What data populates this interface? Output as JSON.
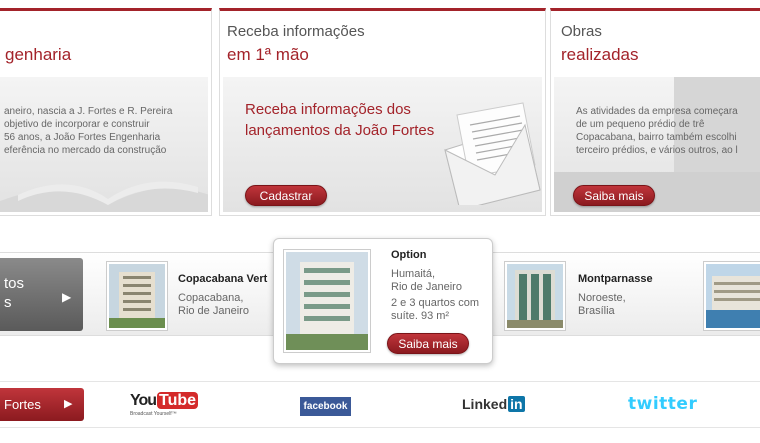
{
  "cards": [
    {
      "title_line1": "",
      "title_line2": "genharia",
      "text_lines": [
        "aneiro, nascia a J. Fortes e R. Pereira",
        "objetivo de incorporar e construir",
        "56 anos, a João Fortes Engenharia",
        "eferência no mercado da construção"
      ]
    },
    {
      "title_line1": "Receba informações",
      "title_line2": "em 1ª mão",
      "promo_line1": "Receba informações dos",
      "promo_line2": "lançamentos da João Fortes",
      "button": "Cadastrar"
    },
    {
      "title_line1": "Obras",
      "title_line2": "realizadas",
      "text_lines": [
        "As atividades da empresa começara",
        "de um pequeno prédio de trê",
        "Copacabana, bairro também escolhi",
        "terceiro prédios, e vários outros, ao l"
      ],
      "button": "Saiba mais"
    }
  ],
  "strip": {
    "left_button_lines": [
      "tos",
      "s"
    ],
    "items": [
      {
        "name": "Copacabana Vert",
        "loc_line1": "Copacabana,",
        "loc_line2": "Rio de Janeiro"
      },
      {
        "name": "Montparnasse",
        "loc_line1": "Noroeste,",
        "loc_line2": "Brasília"
      }
    ],
    "popup": {
      "name": "Option",
      "loc_line1": "Humaitá,",
      "loc_line2": "Rio de Janeiro",
      "desc_line1": "2 e 3 quartos com",
      "desc_line2": "suíte. 93 m²",
      "button": "Saiba mais"
    }
  },
  "footer": {
    "left_button": "Fortes",
    "youtube_you": "You",
    "youtube_tube": "Tube",
    "youtube_tag": "Broadcast Yourself™",
    "facebook": "facebook",
    "linkedin_text": "Linked",
    "linkedin_in": "in",
    "twitter": "twitter"
  },
  "colors": {
    "brand_red": "#a3232a",
    "facebook_blue": "#3b5998",
    "twitter_blue": "#33ccff",
    "linkedin_blue": "#0e76a8"
  }
}
